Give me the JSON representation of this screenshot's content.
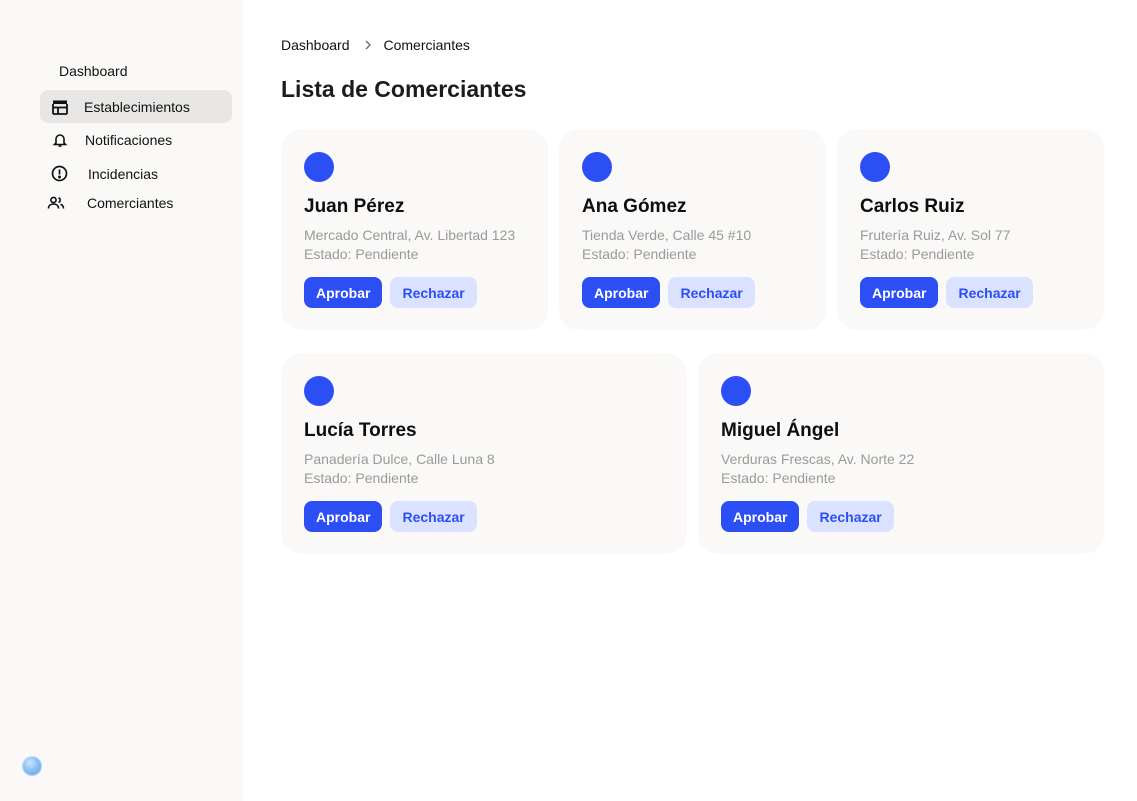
{
  "sidebar": {
    "title": "Dashboard",
    "items": [
      {
        "label": "Establecimientos",
        "icon": "store-icon",
        "active": true
      },
      {
        "label": "Notificaciones",
        "icon": "bell-icon",
        "active": false
      },
      {
        "label": "Incidencias",
        "icon": "alert-circle-icon",
        "active": false
      },
      {
        "label": "Comerciantes",
        "icon": "users-icon",
        "active": false
      }
    ],
    "user_avatar": "user-avatar"
  },
  "breadcrumb": {
    "root": "Dashboard",
    "current": "Comerciantes"
  },
  "page": {
    "title": "Lista de Comerciantes"
  },
  "merchants": [
    {
      "name": "Juan Pérez",
      "address": "Mercado Central, Av. Libertad 123",
      "status": "Estado: Pendiente",
      "approve": "Aprobar",
      "reject": "Rechazar"
    },
    {
      "name": "Ana Gómez",
      "address": "Tienda Verde, Calle 45 #10",
      "status": "Estado: Pendiente",
      "approve": "Aprobar",
      "reject": "Rechazar"
    },
    {
      "name": "Carlos Ruiz",
      "address": "Frutería Ruiz, Av. Sol 77",
      "status": "Estado: Pendiente",
      "approve": "Aprobar",
      "reject": "Rechazar"
    },
    {
      "name": "Lucía Torres",
      "address": "Panadería Dulce, Calle Luna 8",
      "status": "Estado: Pendiente",
      "approve": "Aprobar",
      "reject": "Rechazar"
    },
    {
      "name": "Miguel Ángel",
      "address": "Verduras Frescas, Av. Norte 22",
      "status": "Estado: Pendiente",
      "approve": "Aprobar",
      "reject": "Rechazar"
    }
  ],
  "colors": {
    "accent": "#2b4ff5",
    "accent_soft": "#dbe2ff",
    "sidebar_bg": "#faf9f7",
    "card_bg": "#faf9f7",
    "active_item_bg": "#e8e7e5"
  }
}
